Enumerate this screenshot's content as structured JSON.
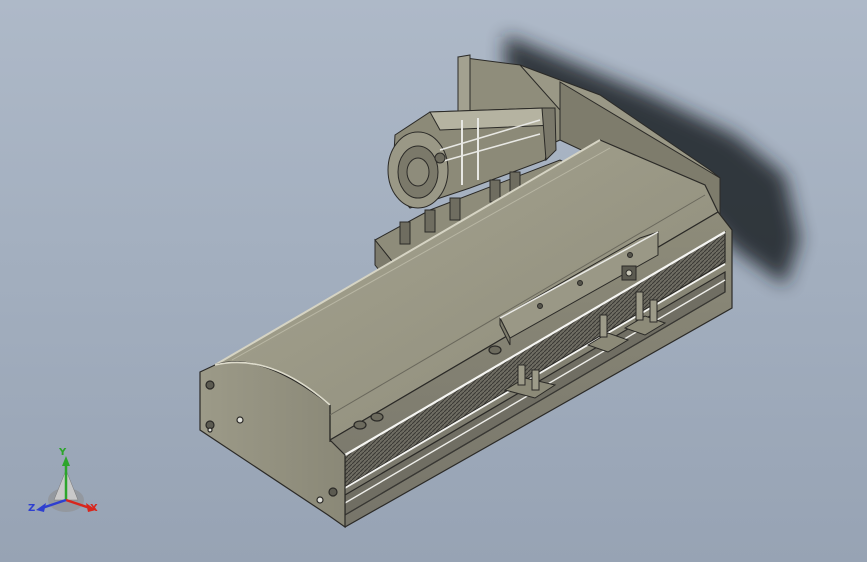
{
  "view": {
    "background_top": "#aeb9c8",
    "background_bottom": "#97a3b4",
    "body_color": "#8d8b79",
    "highlight_color": "#f1f1f1"
  },
  "triad": {
    "x_label": "X",
    "y_label": "Y",
    "z_label": "Z",
    "x_color": "#d8261c",
    "y_color": "#2da52c",
    "z_color": "#2e3fd0"
  }
}
